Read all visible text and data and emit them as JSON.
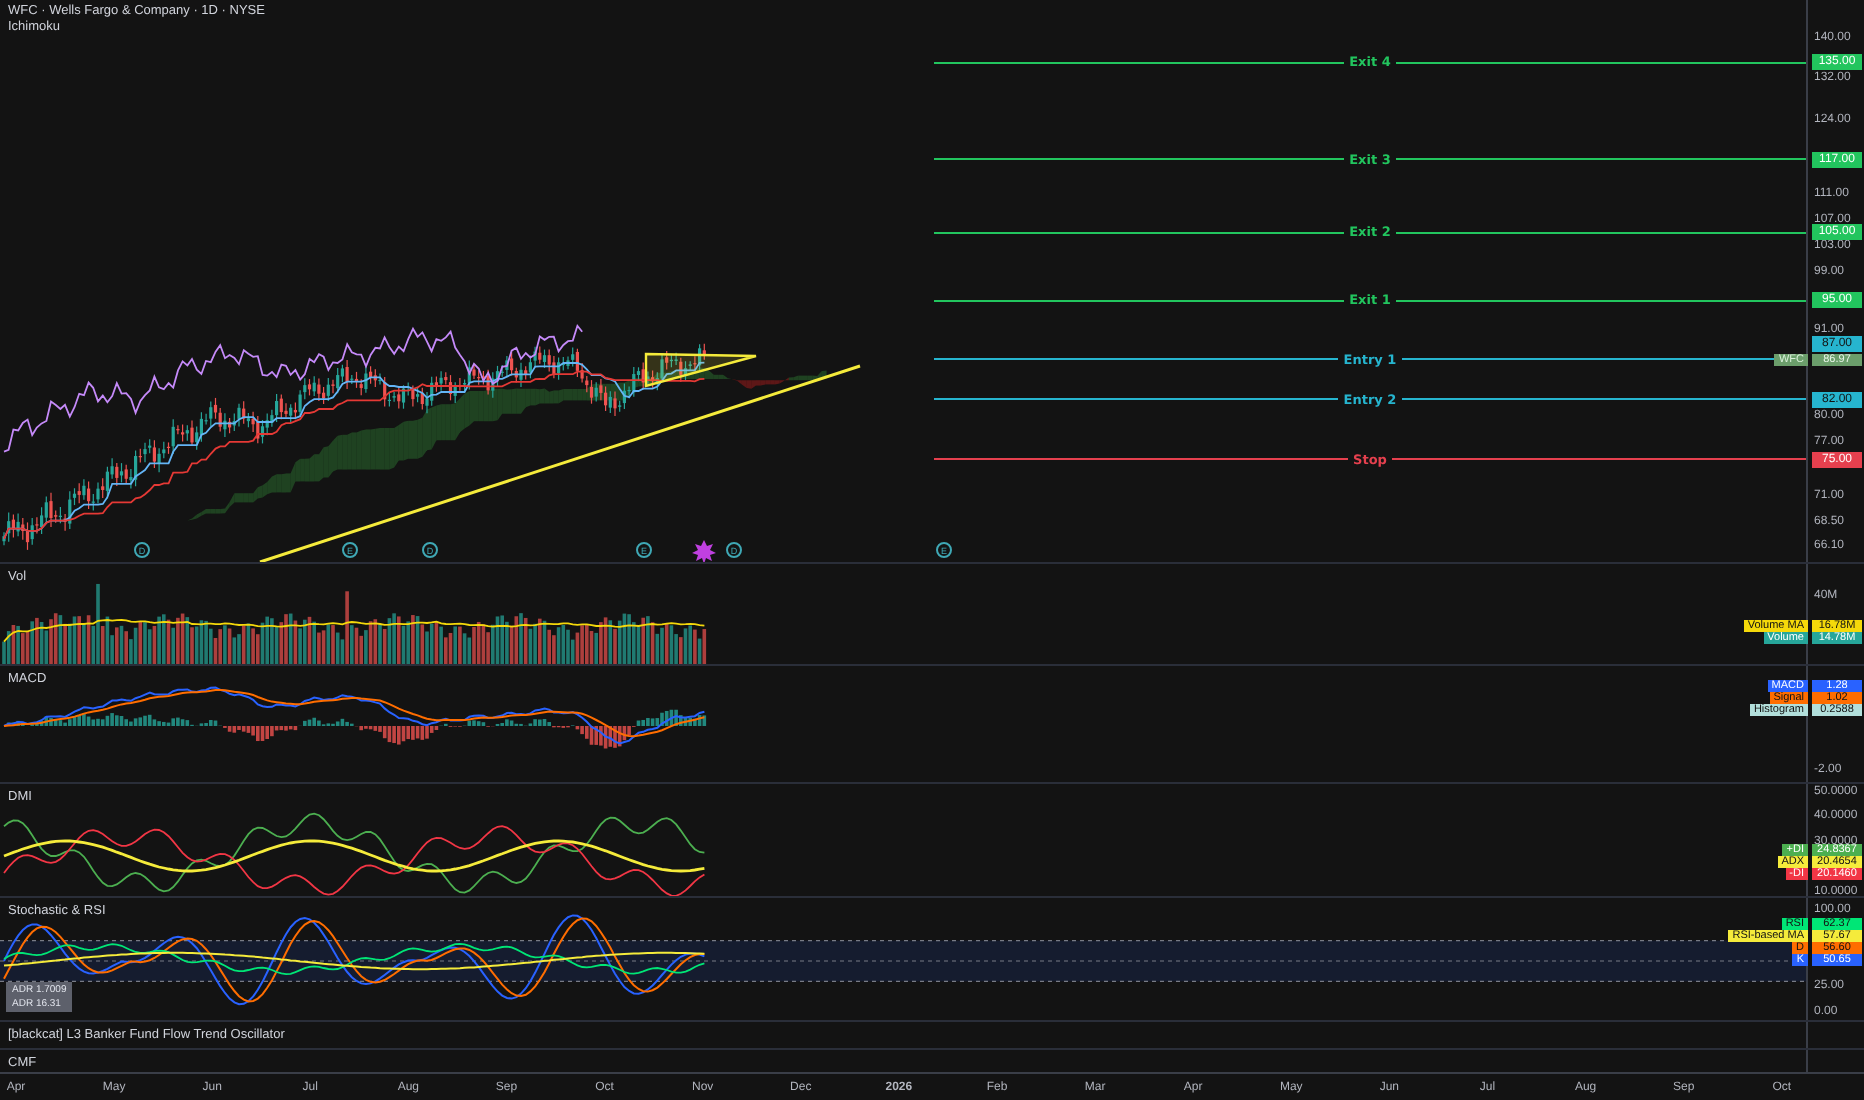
{
  "header": {
    "symbol": "WFC · Wells Fargo & Company · 1D · NYSE",
    "indicator": "Ichimoku"
  },
  "price_scale": {
    "ticks": [
      "140.00",
      "132.00",
      "124.00",
      "111.00",
      "107.00",
      "103.00",
      "99.00",
      "91.00",
      "80.00",
      "77.00",
      "71.00",
      "68.50",
      "66.10"
    ]
  },
  "levels": [
    {
      "label": "Exit 4",
      "price": "135.00",
      "color": "#22c55e"
    },
    {
      "label": "Exit 3",
      "price": "117.00",
      "color": "#22c55e"
    },
    {
      "label": "Exit 2",
      "price": "105.00",
      "color": "#22c55e"
    },
    {
      "label": "Exit 1",
      "price": "95.00",
      "color": "#22c55e"
    },
    {
      "label": "Entry 1",
      "price": "87.00",
      "color": "#26b5cf"
    },
    {
      "label": "Entry 2",
      "price": "82.00",
      "color": "#26b5cf"
    },
    {
      "label": "Stop",
      "price": "75.00",
      "color": "#e5404e"
    }
  ],
  "last_price": {
    "symbol": "WFC",
    "price": "86.97"
  },
  "events": [
    {
      "letter": "D"
    },
    {
      "letter": "E"
    },
    {
      "letter": "D"
    },
    {
      "letter": "E"
    },
    {
      "letter": "D"
    },
    {
      "letter": "E"
    }
  ],
  "panes": [
    {
      "kind": "volume",
      "title": "Vol",
      "ticks": [
        "40M"
      ],
      "legend": [
        {
          "label": "Volume MA",
          "value": "16.78M",
          "color": "#f5d90a"
        },
        {
          "label": "Volume",
          "value": "14.78M",
          "color": "#26a69a"
        }
      ]
    },
    {
      "kind": "macd",
      "title": "MACD",
      "ticks": [
        "-2.00"
      ],
      "legend": [
        {
          "label": "MACD",
          "value": "1.28",
          "color": "#2962ff"
        },
        {
          "label": "Signal",
          "value": "1.02",
          "color": "#ff6d00"
        },
        {
          "label": "Histogram",
          "value": "0.2588",
          "color": "#b2dfdb"
        }
      ]
    },
    {
      "kind": "dmi",
      "title": "DMI",
      "ticks": [
        "50.0000",
        "40.0000",
        "30.0000",
        "10.0000"
      ],
      "legend": [
        {
          "label": "+DI",
          "value": "24.8367",
          "color": "#4caf50"
        },
        {
          "label": "ADX",
          "value": "20.4654",
          "color": "#f5eb3b"
        },
        {
          "label": "-DI",
          "value": "20.1460",
          "color": "#f23645"
        }
      ]
    },
    {
      "kind": "stoch_rsi",
      "title": "Stochastic & RSI",
      "ticks": [
        "100.00",
        "25.00",
        "0.00"
      ],
      "legend": [
        {
          "label": "RSI",
          "value": "62.37",
          "color": "#00e676"
        },
        {
          "label": "RSI-based MA",
          "value": "57.67",
          "color": "#f5eb3b"
        },
        {
          "label": "D",
          "value": "56.60",
          "color": "#ff6d00"
        },
        {
          "label": "K",
          "value": "50.65",
          "color": "#2962ff"
        }
      ],
      "tooltip": [
        "ADR 1.7009",
        "ADR 16.31"
      ]
    },
    {
      "kind": "oscillator",
      "title": "[blackcat] L3 Banker Fund Flow Trend Oscillator"
    },
    {
      "kind": "cmf",
      "title": "CMF"
    }
  ],
  "time_axis": [
    {
      "label": "Apr",
      "year": false
    },
    {
      "label": "May",
      "year": false
    },
    {
      "label": "Jun",
      "year": false
    },
    {
      "label": "Jul",
      "year": false
    },
    {
      "label": "Aug",
      "year": false
    },
    {
      "label": "Sep",
      "year": false
    },
    {
      "label": "Oct",
      "year": false
    },
    {
      "label": "Nov",
      "year": false
    },
    {
      "label": "Dec",
      "year": false
    },
    {
      "label": "2026",
      "year": true
    },
    {
      "label": "Feb",
      "year": false
    },
    {
      "label": "Mar",
      "year": false
    },
    {
      "label": "Apr",
      "year": false
    },
    {
      "label": "May",
      "year": false
    },
    {
      "label": "Jun",
      "year": false
    },
    {
      "label": "Jul",
      "year": false
    },
    {
      "label": "Aug",
      "year": false
    },
    {
      "label": "Sep",
      "year": false
    },
    {
      "label": "Oct",
      "year": false
    }
  ]
}
